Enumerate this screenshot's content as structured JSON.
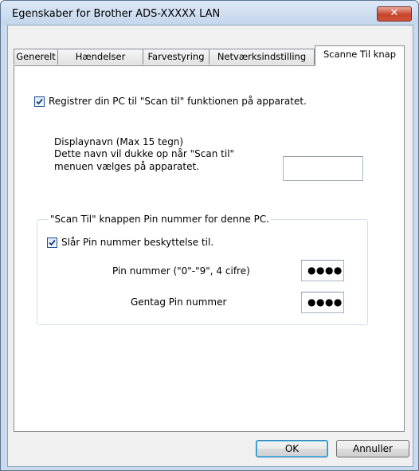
{
  "window": {
    "title": "Egenskaber for Brother ADS-XXXXX LAN",
    "close_glyph": "✕"
  },
  "tabs": [
    {
      "label": "Generelt"
    },
    {
      "label": "Hændelser"
    },
    {
      "label": "Farvestyring"
    },
    {
      "label": "Netværksindstilling"
    },
    {
      "label": "Scanne Til knap",
      "active": true
    }
  ],
  "register": {
    "checked": true,
    "label": "Registrer din PC til \"Scan til\" funktionen på apparatet."
  },
  "display_name": {
    "line1": "Displaynavn (Max 15 tegn)",
    "line2": "Dette navn vil dukke op når \"Scan til\"",
    "line3": "menuen vælges på apparatet.",
    "value": ""
  },
  "pin_group": {
    "legend": "\"Scan Til\" knappen Pin nummer for denne PC.",
    "protect_checked": true,
    "protect_label": "Slår Pin nummer beskyttelse til.",
    "pin_label": "Pin nummer (\"0\"-\"9\", 4 cifre)",
    "pin_value": "●●●●",
    "repeat_label": "Gentag Pin nummer",
    "repeat_value": "●●●●"
  },
  "buttons": {
    "ok": "OK",
    "cancel": "Annuller"
  },
  "colors": {
    "accent": "#3c7fb1",
    "close": "#c7432b",
    "frame": "#cbdaec"
  }
}
